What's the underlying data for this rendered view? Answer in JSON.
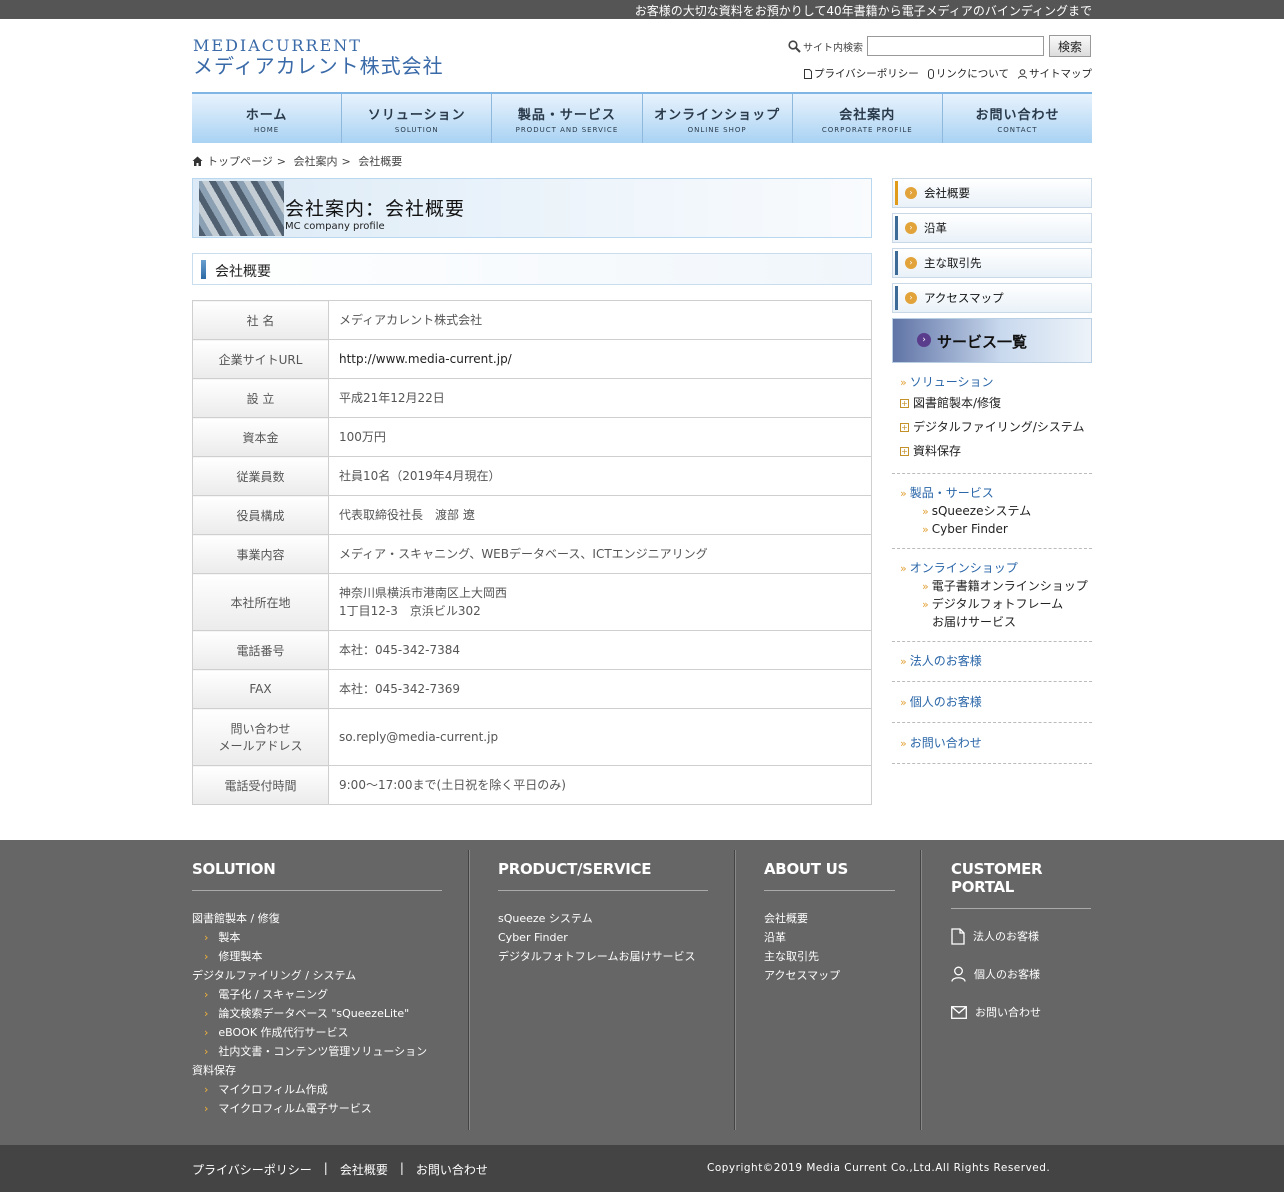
{
  "topbar": {
    "tagline": "お客様の大切な資料をお預かりして40年書籍から電子メディアのバインディングまで"
  },
  "logo": {
    "en": "MEDIACURRENT",
    "jp": "メディアカレント株式会社"
  },
  "search": {
    "label": "サイト内検索",
    "value": "",
    "button": "検索"
  },
  "util": [
    "プライバシーポリシー",
    "リンクについて",
    "サイトマップ"
  ],
  "nav": [
    {
      "jp": "ホーム",
      "en": "HOME"
    },
    {
      "jp": "ソリューション",
      "en": "SOLUTION"
    },
    {
      "jp": "製品・サービス",
      "en": "PRODUCT AND SERVICE"
    },
    {
      "jp": "オンラインショップ",
      "en": "ONLINE SHOP"
    },
    {
      "jp": "会社案内",
      "en": "CORPORATE PROFILE"
    },
    {
      "jp": "お問い合わせ",
      "en": "CONTACT"
    }
  ],
  "breadcrumb": [
    "トップページ",
    "会社案内",
    "会社概要"
  ],
  "banner": {
    "title": "会社案内：会社概要",
    "sub": "MC company profile"
  },
  "section_title": "会社概要",
  "profile": [
    {
      "k": "社 名",
      "v": "メディアカレント株式会社"
    },
    {
      "k": "企業サイトURL",
      "v": "http://www.media-current.jp/"
    },
    {
      "k": "設 立",
      "v": "平成21年12月22日"
    },
    {
      "k": "資本金",
      "v": "100万円"
    },
    {
      "k": "従業員数",
      "v": "社員10名（2019年4月現在）"
    },
    {
      "k": "役員構成",
      "v": "代表取締役社長　渡部 遼"
    },
    {
      "k": "事業内容",
      "v": "メディア・スキャニング、WEBデータベース、ICTエンジニアリング"
    },
    {
      "k": "本社所在地",
      "v1": "神奈川県横浜市港南区上大岡西",
      "v2": "1丁目12-3　京浜ビル302"
    },
    {
      "k": "電話番号",
      "v": "本社：045-342-7384"
    },
    {
      "k": "FAX",
      "v": "本社：045-342-7369"
    },
    {
      "k1": "問い合わせ",
      "k2": "メールアドレス",
      "v": "so.reply@media-current.jp"
    },
    {
      "k": "電話受付時間",
      "v": "9:00～17:00まで(土日祝を除く平日のみ)"
    }
  ],
  "side": {
    "menu": [
      "会社概要",
      "沿革",
      "主な取引先",
      "アクセスマップ"
    ],
    "service_head": "サービス一覧",
    "solution": "ソリューション",
    "solution_items": [
      "図書館製本/修復",
      "デジタルファイリング/システム",
      "資料保存"
    ],
    "product": "製品・サービス",
    "product_items": [
      "sQueezeシステム",
      "Cyber Finder"
    ],
    "shop": "オンラインショップ",
    "shop_items": [
      "電子書籍オンラインショップ",
      "デジタルフォトフレーム"
    ],
    "shop_item_cont": "お届けサービス",
    "corp": "法人のお客様",
    "personal": "個人のお客様",
    "contact": "お問い合わせ"
  },
  "footer": {
    "solution": {
      "title": "SOLUTION",
      "items": [
        {
          "t": "図書館製本 / 修復",
          "ind": false
        },
        {
          "t": "製本",
          "ind": true
        },
        {
          "t": "修理製本",
          "ind": true
        },
        {
          "t": "デジタルファイリング / システム",
          "ind": false
        },
        {
          "t": "電子化 / スキャニング",
          "ind": true
        },
        {
          "t": "論文検索データベース \"sQueezeLite\"",
          "ind": true
        },
        {
          "t": "eBOOK 作成代行サービス",
          "ind": true
        },
        {
          "t": "社内文書・コンテンツ管理ソリューション",
          "ind": true
        },
        {
          "t": "資料保存",
          "ind": false
        },
        {
          "t": "マイクロフィルム作成",
          "ind": true
        },
        {
          "t": "マイクロフィルム電子サービス",
          "ind": true
        }
      ]
    },
    "product": {
      "title": "PRODUCT/SERVICE",
      "items": [
        "sQueeze システム",
        "Cyber Finder",
        "デジタルフォトフレームお届けサービス"
      ]
    },
    "about": {
      "title": "ABOUT US",
      "items": [
        "会社概要",
        "沿革",
        "主な取引先",
        "アクセスマップ"
      ]
    },
    "portal": {
      "title": "CUSTOMER PORTAL",
      "items": [
        "法人のお客様",
        "個人のお客様",
        "お問い合わせ"
      ]
    }
  },
  "bottom": {
    "links": [
      "プライバシーポリシー",
      "会社概要",
      "お問い合わせ"
    ],
    "sep": "|",
    "copyright": "Copyright©2019 Media Current Co.,Ltd.All Rights Reserved."
  }
}
